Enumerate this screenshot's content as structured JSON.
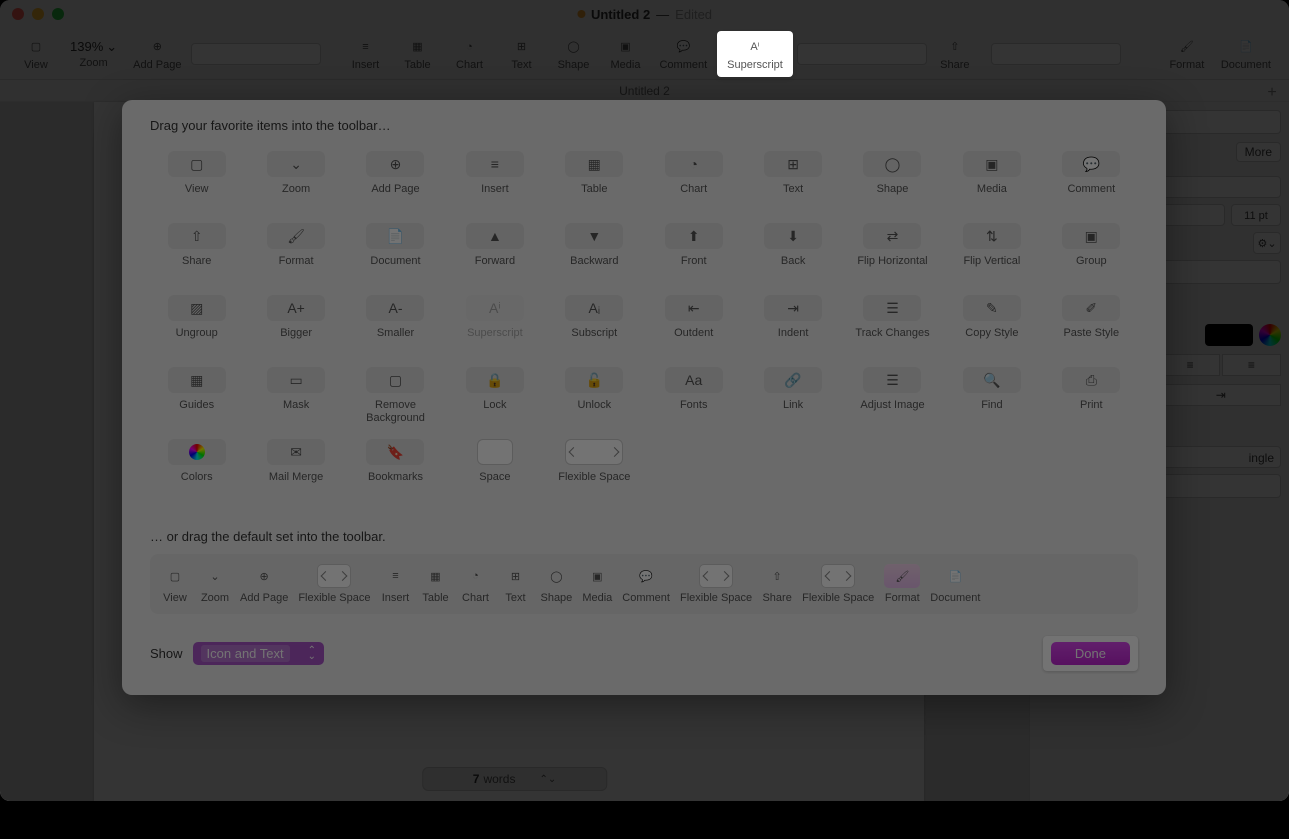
{
  "window": {
    "title": "Untitled 2",
    "status": "Edited",
    "doc_tab": "Untitled 2"
  },
  "toolbar": {
    "view": "View",
    "zoom": "Zoom",
    "zoom_value": "139%",
    "add_page": "Add Page",
    "insert": "Insert",
    "table": "Table",
    "chart": "Chart",
    "text": "Text",
    "shape": "Shape",
    "media": "Media",
    "comment": "Comment",
    "superscript": "Superscript",
    "share": "Share",
    "format": "Format",
    "document": "Document"
  },
  "sheet": {
    "title": "Drag your favorite items into the toolbar…",
    "subtitle": "… or drag the default set into the toolbar.",
    "show_label": "Show",
    "show_value": "Icon and Text",
    "done": "Done",
    "items": [
      {
        "label": "View",
        "icon": "view"
      },
      {
        "label": "Zoom",
        "icon": "zoom"
      },
      {
        "label": "Add Page",
        "icon": "addpage"
      },
      {
        "label": "Insert",
        "icon": "insert"
      },
      {
        "label": "Table",
        "icon": "table"
      },
      {
        "label": "Chart",
        "icon": "chart"
      },
      {
        "label": "Text",
        "icon": "text"
      },
      {
        "label": "Shape",
        "icon": "shape"
      },
      {
        "label": "Media",
        "icon": "media"
      },
      {
        "label": "Comment",
        "icon": "comment"
      },
      {
        "label": "Share",
        "icon": "share"
      },
      {
        "label": "Format",
        "icon": "format"
      },
      {
        "label": "Document",
        "icon": "document"
      },
      {
        "label": "Forward",
        "icon": "forward"
      },
      {
        "label": "Backward",
        "icon": "backward"
      },
      {
        "label": "Front",
        "icon": "front"
      },
      {
        "label": "Back",
        "icon": "back"
      },
      {
        "label": "Flip Horizontal",
        "icon": "fliph"
      },
      {
        "label": "Flip Vertical",
        "icon": "flipv"
      },
      {
        "label": "Group",
        "icon": "group"
      },
      {
        "label": "Ungroup",
        "icon": "ungroup"
      },
      {
        "label": "Bigger",
        "icon": "bigger"
      },
      {
        "label": "Smaller",
        "icon": "smaller"
      },
      {
        "label": "Superscript",
        "icon": "superscript",
        "dimmed": true
      },
      {
        "label": "Subscript",
        "icon": "subscript"
      },
      {
        "label": "Outdent",
        "icon": "outdent"
      },
      {
        "label": "Indent",
        "icon": "indent"
      },
      {
        "label": "Track Changes",
        "icon": "track"
      },
      {
        "label": "Copy Style",
        "icon": "copystyle"
      },
      {
        "label": "Paste Style",
        "icon": "pastestyle"
      },
      {
        "label": "Guides",
        "icon": "guides"
      },
      {
        "label": "Mask",
        "icon": "mask"
      },
      {
        "label": "Remove Background",
        "icon": "removebg"
      },
      {
        "label": "Lock",
        "icon": "lock"
      },
      {
        "label": "Unlock",
        "icon": "unlock"
      },
      {
        "label": "Fonts",
        "icon": "fonts"
      },
      {
        "label": "Link",
        "icon": "link"
      },
      {
        "label": "Adjust Image",
        "icon": "adjust"
      },
      {
        "label": "Find",
        "icon": "find"
      },
      {
        "label": "Print",
        "icon": "print"
      },
      {
        "label": "Colors",
        "icon": "colors"
      },
      {
        "label": "Mail Merge",
        "icon": "mailmerge"
      },
      {
        "label": "Bookmarks",
        "icon": "bookmarks"
      },
      {
        "label": "Space",
        "icon": "space"
      },
      {
        "label": "Flexible Space",
        "icon": "flex"
      }
    ],
    "defaults": [
      {
        "label": "View",
        "icon": "view"
      },
      {
        "label": "Zoom",
        "icon": "zoom"
      },
      {
        "label": "Add Page",
        "icon": "addpage"
      },
      {
        "label": "Flexible Space",
        "icon": "flex"
      },
      {
        "label": "Insert",
        "icon": "insert"
      },
      {
        "label": "Table",
        "icon": "table"
      },
      {
        "label": "Chart",
        "icon": "chart"
      },
      {
        "label": "Text",
        "icon": "text"
      },
      {
        "label": "Shape",
        "icon": "shape"
      },
      {
        "label": "Media",
        "icon": "media"
      },
      {
        "label": "Comment",
        "icon": "comment"
      },
      {
        "label": "Flexible Space",
        "icon": "flex"
      },
      {
        "label": "Share",
        "icon": "share"
      },
      {
        "label": "Flexible Space",
        "icon": "flex"
      },
      {
        "label": "Format",
        "icon": "format"
      },
      {
        "label": "Document",
        "icon": "document"
      }
    ]
  },
  "inspector": {
    "more": "More",
    "font_size": "11 pt",
    "spacing_value": "ingle"
  },
  "wordcount": {
    "count": "7",
    "unit": "words"
  },
  "icons": {
    "view": "▢",
    "zoom": "⌄",
    "addpage": "⊕",
    "insert": "≡",
    "table": "▦",
    "chart": "◔",
    "text": "⊞",
    "shape": "◯",
    "media": "▣",
    "comment": "💬",
    "share": "⇧",
    "format": "🖌",
    "document": "📄",
    "forward": "▲",
    "backward": "▼",
    "front": "⬆",
    "back": "⬇",
    "fliph": "⇄",
    "flipv": "⇅",
    "group": "▣",
    "ungroup": "▨",
    "bigger": "A+",
    "smaller": "A-",
    "superscript": "Aⁱ",
    "subscript": "Aᵢ",
    "outdent": "⇤",
    "indent": "⇥",
    "track": "☰",
    "copystyle": "✎",
    "pastestyle": "✐",
    "guides": "▦",
    "mask": "▭",
    "removebg": "▢",
    "lock": "🔒",
    "unlock": "🔓",
    "fonts": "Aa",
    "link": "🔗",
    "adjust": "☰",
    "find": "🔍",
    "print": "⎙",
    "colors": "●",
    "mailmerge": "✉",
    "bookmarks": "🔖",
    "space": " ",
    "flex": " "
  }
}
